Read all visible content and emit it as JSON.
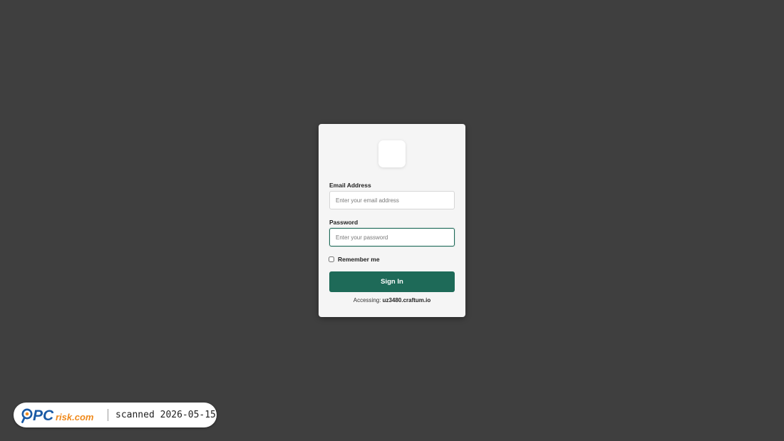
{
  "login_form": {
    "email_label": "Email Address",
    "email_placeholder": "Enter your email address",
    "email_value": "",
    "password_label": "Password",
    "password_placeholder": "Enter your password",
    "password_value": "",
    "remember_label": "Remember me",
    "remember_checked": false,
    "signin_label": "Sign In",
    "accessing_prefix": "Accessing:",
    "accessing_domain": "uz3480.craftum.io"
  },
  "watermark": {
    "logo_text_pc": "PC",
    "logo_text_risk": "risk.com",
    "scan_text": "scanned 2026-05-15"
  },
  "colors": {
    "page_background": "#3f3f3f",
    "card_background": "#f5f5f5",
    "accent": "#1e6a58",
    "watermark_blue": "#1a5aa5",
    "watermark_orange": "#f08a1c"
  },
  "icons": {
    "app_logo": "blank-logo-icon",
    "watermark_logo": "pcrisk-magnifier-icon"
  }
}
